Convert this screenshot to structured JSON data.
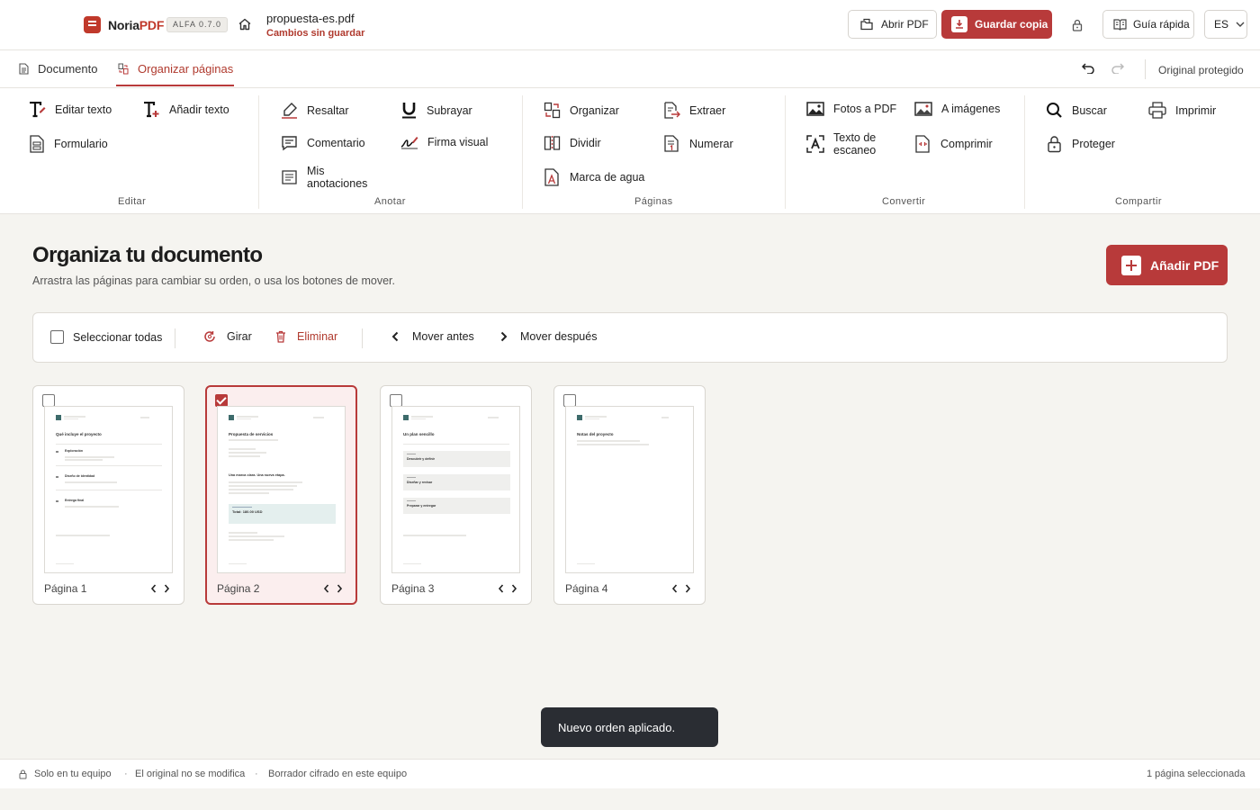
{
  "app": {
    "brand_main": "Noria",
    "brand_pdf": "PDF",
    "version": "ALFA 0.7.0"
  },
  "file": {
    "name": "propuesta-es.pdf",
    "status": "Cambios sin guardar"
  },
  "header": {
    "open_label": "Abrir PDF",
    "save_label": "Guardar copia",
    "guide_label": "Guía rápida",
    "language": "ES"
  },
  "tabs": [
    {
      "label": "Documento"
    },
    {
      "label": "Organizar páginas"
    }
  ],
  "protected_label": "Original protegido",
  "ribbon": {
    "groups": [
      {
        "label": "Editar",
        "items": [
          {
            "label": "Editar texto"
          },
          {
            "label": "Añadir texto"
          },
          {
            "label": "Formulario"
          }
        ]
      },
      {
        "label": "Anotar",
        "items": [
          {
            "label": "Resaltar"
          },
          {
            "label": "Subrayar"
          },
          {
            "label": "Comentario"
          },
          {
            "label": "Firma visual"
          },
          {
            "label": "Mis anotaciones"
          }
        ]
      },
      {
        "label": "Páginas",
        "items": [
          {
            "label": "Organizar"
          },
          {
            "label": "Extraer"
          },
          {
            "label": "Dividir"
          },
          {
            "label": "Numerar"
          },
          {
            "label": "Marca de agua"
          }
        ]
      },
      {
        "label": "Convertir",
        "items": [
          {
            "label": "Fotos a PDF"
          },
          {
            "label": "A imágenes"
          },
          {
            "label": "Texto de escaneo"
          },
          {
            "label": "Comprimir"
          }
        ]
      },
      {
        "label": "Compartir",
        "items": [
          {
            "label": "Buscar"
          },
          {
            "label": "Imprimir"
          },
          {
            "label": "Proteger"
          }
        ]
      }
    ]
  },
  "main": {
    "title": "Organiza tu documento",
    "subtitle": "Arrastra las páginas para cambiar su orden, o usa los botones de mover.",
    "add_pdf_label": "Añadir PDF"
  },
  "toolbar": {
    "select_all": "Seleccionar todas",
    "rotate": "Girar",
    "delete": "Eliminar",
    "move_before": "Mover antes",
    "move_after": "Mover después"
  },
  "pages": [
    {
      "label": "Página 1",
      "selected": false,
      "heading": "Qué incluye el proyecto",
      "items": [
        "Exploración",
        "Diseño de identidad",
        "Entrega final"
      ]
    },
    {
      "label": "Página 2",
      "selected": true,
      "heading": "Propuesta de servicios",
      "subheading": "Una marca clara. Una nueva etapa.",
      "total": "Total: 180.00 USD"
    },
    {
      "label": "Página 3",
      "selected": false,
      "heading": "Un plan sencillo",
      "steps": [
        "Descubrir y definir",
        "Diseñar y revisar",
        "Preparar y entregar"
      ]
    },
    {
      "label": "Página 4",
      "selected": false,
      "heading": "Notas del proyecto"
    }
  ],
  "toast": "Nuevo orden aplicado.",
  "footer": {
    "local": "Solo en tu equipo",
    "original": "El original no se modifica",
    "draft": "Borrador cifrado en este equipo",
    "selection": "1 página seleccionada"
  },
  "colors": {
    "accent": "#b83a3a",
    "background": "#f5f4f0",
    "toast": "#2a2d33"
  }
}
